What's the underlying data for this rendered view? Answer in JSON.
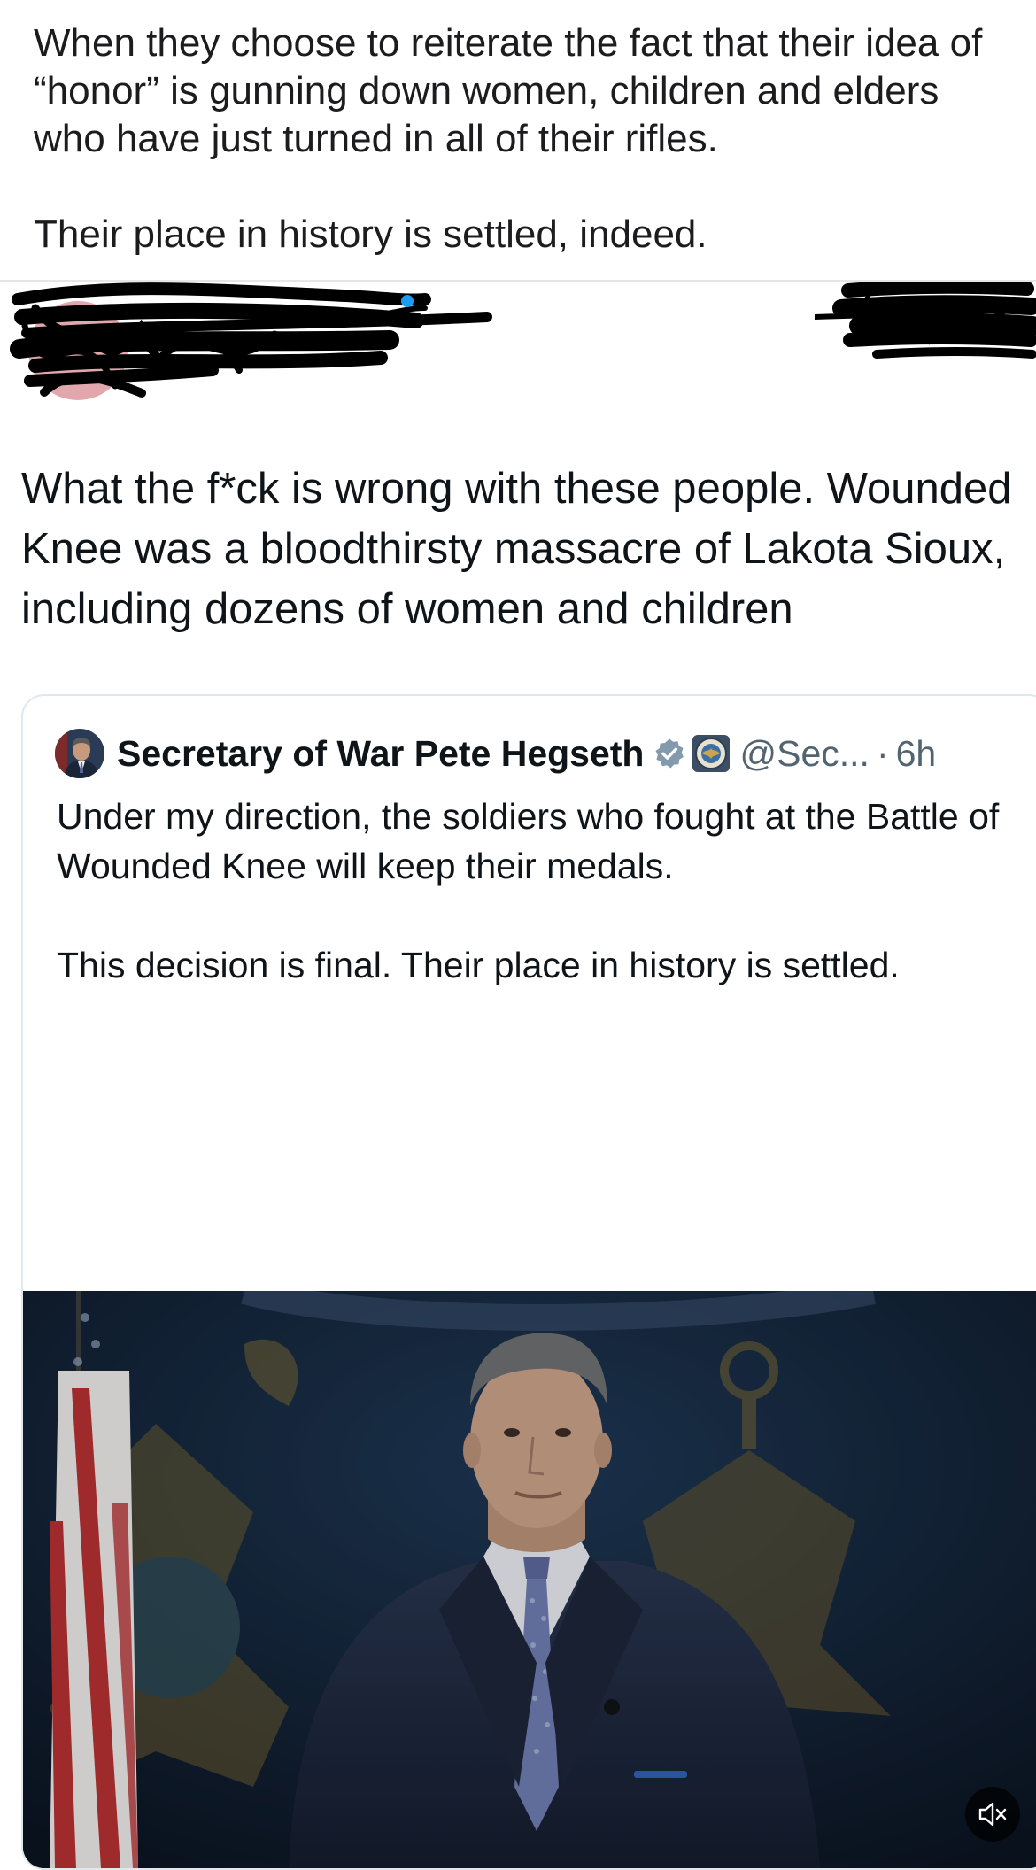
{
  "caption": {
    "paragraph_1": "When they choose to reiterate the fact that their idea of “honor” is gunning down women, children and elders who have just turned in all of their rifles.",
    "paragraph_2": "Their place in history is settled, indeed."
  },
  "tweet": {
    "text": "What the f*ck is wrong with these people. Wounded Knee was a bloodthirsty massacre of Lakota Sioux, including dozens of women and children",
    "author_redacted": true
  },
  "quoted_tweet": {
    "display_name": "Secretary of War Pete Hegseth",
    "handle": "@Sec...",
    "separator": "·",
    "time": "6h",
    "verified_icon": "verified-badge-icon",
    "affiliation_icon": "government-seal-icon",
    "text_line_1": "Under my direction, the soldiers who fought at the Battle of Wounded Knee will keep their medals.",
    "text_line_2": "This decision is final. Their place in history is settled.",
    "media": {
      "type": "video",
      "mute_icon": "speaker-muted-icon"
    }
  },
  "colors": {
    "text_primary": "#0f1419",
    "text_secondary": "#536471",
    "verified_blue": "#829aab",
    "card_border": "#e1e8ed",
    "redaction_ink": "#000000"
  }
}
